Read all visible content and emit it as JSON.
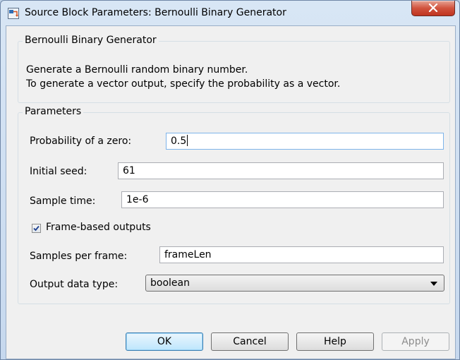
{
  "window": {
    "title": "Source Block Parameters: Bernoulli Binary Generator"
  },
  "description_group": {
    "title": "Bernoulli Binary Generator",
    "lines": [
      "Generate a Bernoulli random binary number.",
      "To generate a vector output, specify the probability as a vector."
    ]
  },
  "parameters": {
    "title": "Parameters",
    "probability_zero": {
      "label": "Probability of a zero:",
      "value": "0.5"
    },
    "initial_seed": {
      "label": "Initial seed:",
      "value": "61"
    },
    "sample_time": {
      "label": "Sample time:",
      "value": "1e-6"
    },
    "frame_based": {
      "label": "Frame-based outputs",
      "checked": true
    },
    "samples_per_frame": {
      "label": "Samples per frame:",
      "value": "frameLen"
    },
    "output_data_type": {
      "label": "Output data type:",
      "selected": "boolean"
    }
  },
  "buttons": {
    "ok": "OK",
    "cancel": "Cancel",
    "help": "Help",
    "apply": "Apply"
  },
  "icons": {
    "title": "simulink-block-icon",
    "close": "close-icon",
    "checkbox": "checkmark-icon",
    "dropdown": "chevron-down-icon"
  },
  "colors": {
    "close_button": "#c8402c",
    "window_frame": "#c6d8ee",
    "dialog_background": "#f0f0f0"
  }
}
